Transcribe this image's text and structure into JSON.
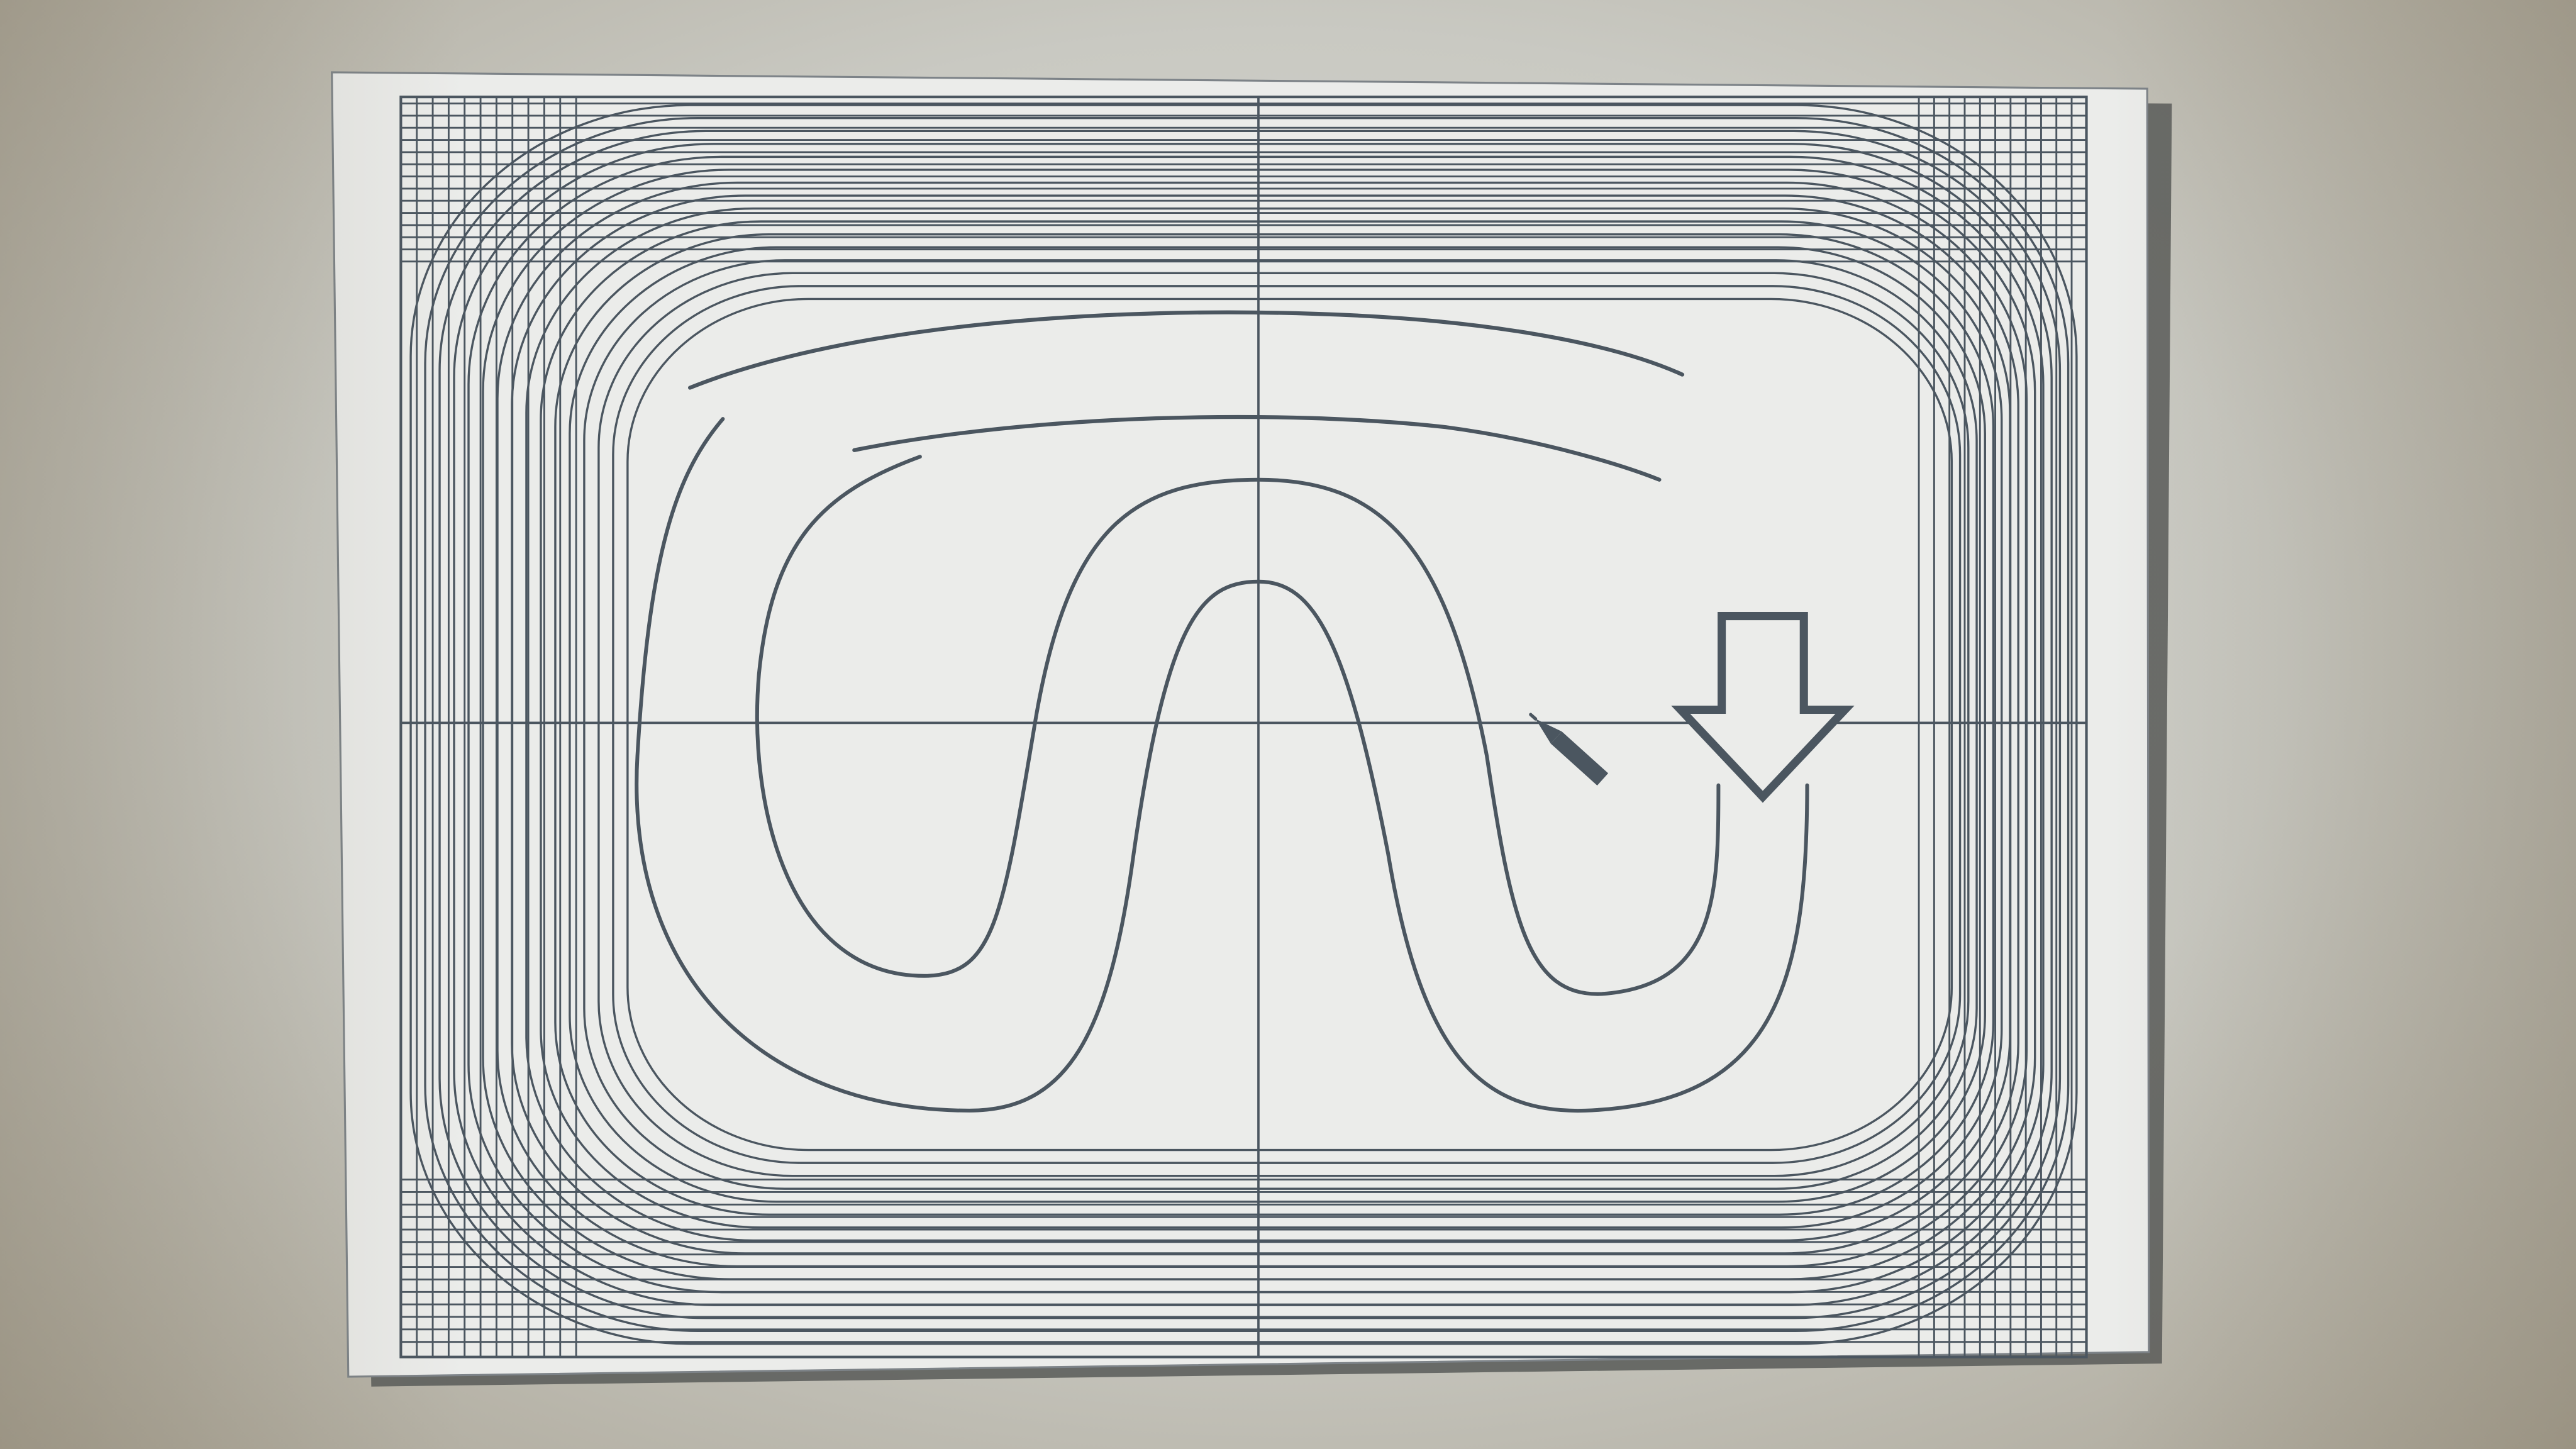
{
  "colors": {
    "ink": "#4b5660",
    "paper": "#ebecea",
    "sheet_shadow": "#585a58"
  },
  "icons": {
    "pointer": "pencil-icon",
    "arrow": "down-arrow-icon"
  }
}
